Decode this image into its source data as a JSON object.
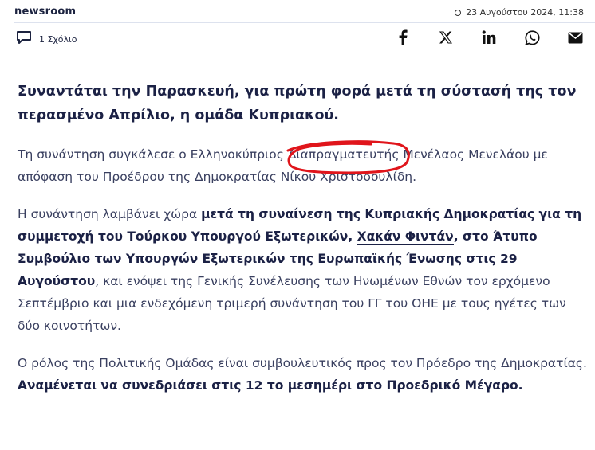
{
  "header": {
    "brand": "newsroom",
    "date": "23 Αυγούστου 2024, 11:38",
    "clock_icon": "clock-icon"
  },
  "actions": {
    "comment_label": "1 Σχόλιο",
    "comment_icon": "comment-icon",
    "share_icons": [
      "facebook-icon",
      "x-icon",
      "linkedin-icon",
      "whatsapp-icon",
      "email-icon"
    ]
  },
  "article": {
    "lead": "Συναντάται την Παρασκευή, για πρώτη φορά μετά τη σύστασή της τον περασμένο Απρίλιο, η ομάδα Κυπριακού.",
    "p1": {
      "before": "Τη συνάντηση συγκάλεσε ο Ελληνοκύπριος ",
      "circled": "Διαπραγματευτής",
      "after": " Μενέλαος Μενελάου με απόφαση του Προέδρου της Δημοκρατίας Νίκου Χριστοδουλίδη."
    },
    "p2": {
      "t1": "Η συνάντηση λαμβάνει χώρα ",
      "b1": "μετά τη συναίνεση της Κυπριακής Δημοκρατίας για τη συμμετοχή του Τούρκου Υπουργού Εξωτερικών, ",
      "link": "Χακάν Φιντάν",
      "b2": ", στο Άτυπο Συμβούλιο των Υπουργών Εξωτερικών της Ευρωπαϊκής Ένωσης στις 29 Αυγούστου",
      "t2": ", και ενόψει της Γενικής Συνέλευσης των Ηνωμένων Εθνών τον ερχόμενο Σεπτέμβριο και μια ενδεχόμενη τριμερή συνάντηση του ΓΓ του ΟΗΕ με τους ηγέτες των δύο κοινοτήτων."
    },
    "p3": {
      "t1": "Ο ρόλος της Πολιτικής Ομάδας είναι συμβουλευτικός προς τον Πρόεδρο της Δημοκρατίας. ",
      "b1": "Αναμένεται να συνεδριάσει στις 12 το μεσημέρι στο Προεδρικό Μέγαρο."
    }
  },
  "colors": {
    "text_dark": "#1b2145",
    "text_body": "#3a4060",
    "annotation_red": "#e0151b"
  }
}
